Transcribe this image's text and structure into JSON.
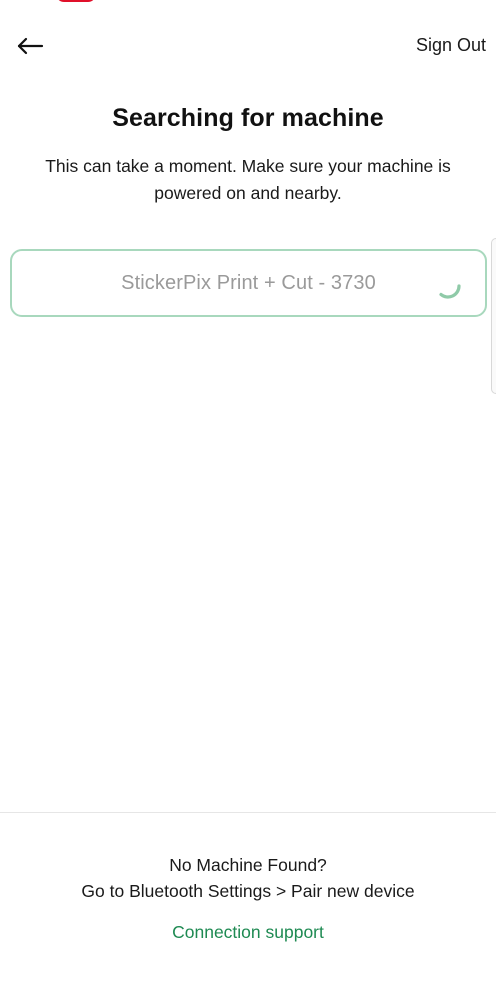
{
  "header": {
    "back_icon": "arrow-left-icon",
    "sign_out_label": "Sign Out"
  },
  "main": {
    "title": "Searching for machine",
    "subtitle": "This can take a moment. Make sure your machine is powered on and nearby.",
    "machines": [
      {
        "name": "StickerPix Print + Cut - 3730",
        "status_icon": "loading-spinner-icon"
      }
    ]
  },
  "footer": {
    "no_machine_text": "No Machine Found?",
    "bluetooth_instructions": "Go to Bluetooth Settings > Pair new device",
    "support_link_label": "Connection support"
  },
  "colors": {
    "accent_green": "#1e8a52",
    "row_border": "#a8d8bd",
    "spinner": "#8fcaa8"
  }
}
